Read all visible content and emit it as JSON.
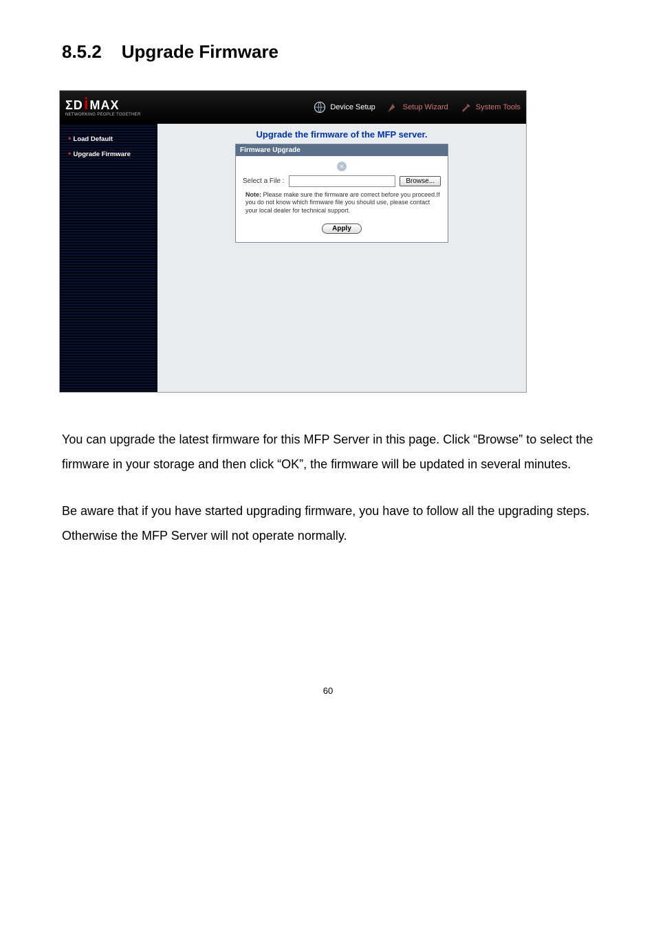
{
  "section": {
    "number": "8.5.2",
    "title": "Upgrade Firmware"
  },
  "logo": {
    "text_left": "ΣD",
    "text_right": "MAX",
    "subtitle": "NETWORKING PEOPLE TOGETHER"
  },
  "tabs": {
    "device_setup": "Device Setup",
    "setup_wizard": "Setup Wizard",
    "system_tools": "System Tools"
  },
  "sidebar": {
    "items": [
      {
        "label": "Load Default"
      },
      {
        "label": "Upgrade Firmware"
      }
    ]
  },
  "pane": {
    "title": "Upgrade the firmware of the MFP server.",
    "panel_head": "Firmware Upgrade",
    "select_label": "Select a File :",
    "browse_btn": "Browse...",
    "note_bold": "Note:",
    "note_text": " Please make sure the firmware are correct before you proceed.If you do not know which firmware file you should use, please contact your local dealer for technical support.",
    "apply_btn": "Apply"
  },
  "paragraphs": {
    "p1": "You can upgrade the latest firmware for this MFP Server in this page. Click “Browse” to select the firmware in your storage and then click “OK”, the firmware will be updated in several minutes.",
    "p2": "Be aware that if you have started upgrading firmware, you have to follow all the upgrading steps. Otherwise the MFP Server will not operate normally."
  },
  "page_number": "60"
}
